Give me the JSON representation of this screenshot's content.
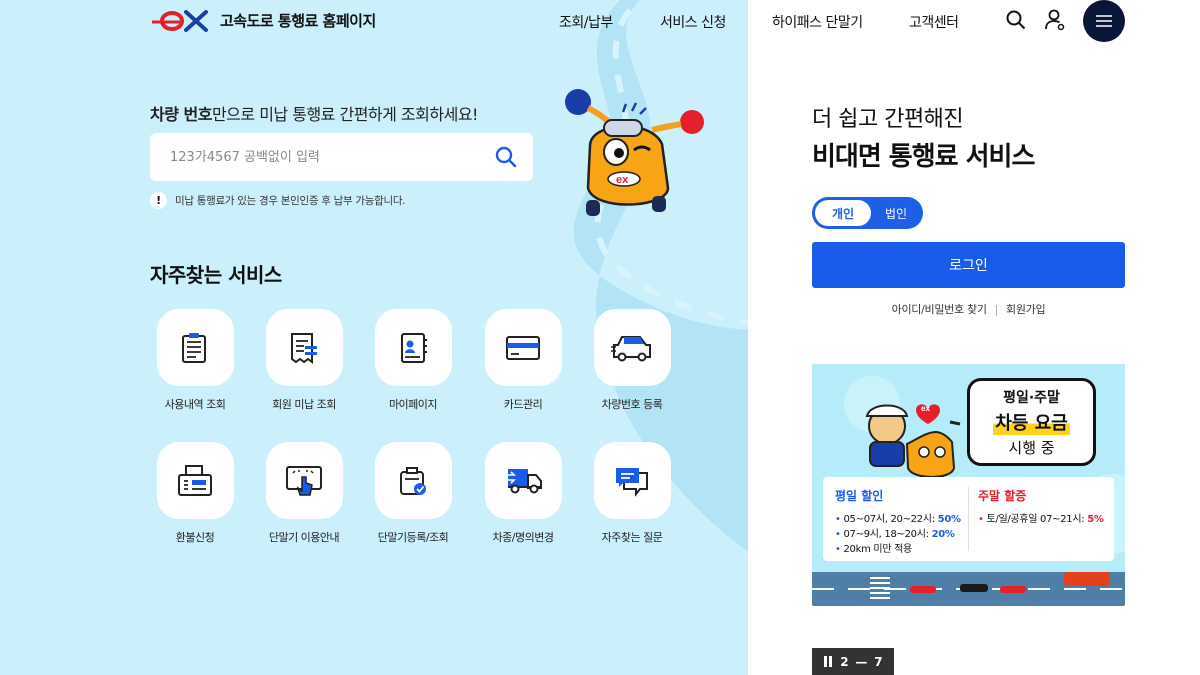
{
  "header": {
    "title": "고속도로 통행료 홈페이지",
    "nav": [
      "조회/납부",
      "서비스 신청",
      "하이패스 단말기",
      "고객센터"
    ]
  },
  "search": {
    "heading_bold": "차량 번호",
    "heading_rest": "만으로 미납 통행료 간편하게 조회하세요!",
    "placeholder": "123가4567 공백없이 입력",
    "notice_badge": "!",
    "notice": "미납 통행료가 있는 경우 본인인증 후 납부 가능합니다."
  },
  "services": {
    "title": "자주찾는 서비스",
    "items": [
      {
        "label": "사용내역 조회",
        "icon": "usage-history-icon"
      },
      {
        "label": "회원 미납 조회",
        "icon": "unpaid-receipt-icon"
      },
      {
        "label": "마이페이지",
        "icon": "profile-card-icon"
      },
      {
        "label": "카드관리",
        "icon": "credit-card-icon"
      },
      {
        "label": "차량번호 등록",
        "icon": "car-register-icon"
      },
      {
        "label": "환불신청",
        "icon": "refund-printer-icon"
      },
      {
        "label": "단말기 이용안내",
        "icon": "terminal-guide-icon"
      },
      {
        "label": "단말기등록/조회",
        "icon": "terminal-register-icon"
      },
      {
        "label": "차종/명의변경",
        "icon": "truck-change-icon"
      },
      {
        "label": "자주찾는 질문",
        "icon": "faq-chat-icon"
      }
    ]
  },
  "right": {
    "subtitle": "더 쉽고 간편해진",
    "title": "비대면 통행료 서비스",
    "toggle": {
      "on": "개인",
      "off": "법인"
    },
    "login": "로그인",
    "link_find": "아이디/비밀번호 찾기",
    "link_sep": "|",
    "link_join": "회원가입"
  },
  "banner": {
    "bubble_line1": "평일·주말",
    "bubble_line2": "차등 요금",
    "bubble_line3": "시행 중",
    "weekday_heading": "평일 할인",
    "weekday_1_text": "05~07시, 20~22시: ",
    "weekday_1_pct": "50%",
    "weekday_2_text": "07~9시, 18~20시: ",
    "weekday_2_pct": "20%",
    "weekday_3_text": "20km 미만 적용",
    "weekend_heading": "주말 할증",
    "weekend_1_text": "토/일/공휴일 07~21시: ",
    "weekend_1_pct": "5%",
    "badge": "ex"
  },
  "pager": {
    "current": "2",
    "dash": "—",
    "total": "7"
  },
  "colors": {
    "brand_blue": "#1a5cea",
    "brand_red": "#e5202d",
    "sky": "#ccf0fb",
    "navy": "#0a1638"
  }
}
